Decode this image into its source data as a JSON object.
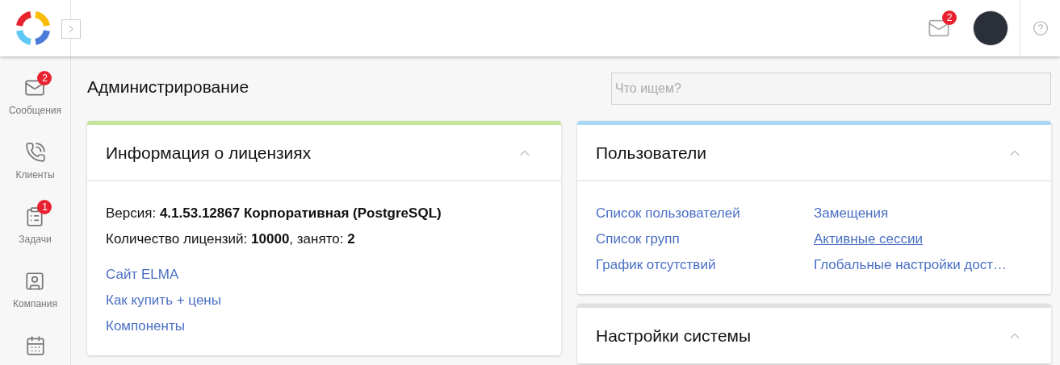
{
  "header": {
    "mail_badge": "2"
  },
  "sidebar": {
    "items": [
      {
        "kind": "messages",
        "label": "Сообщения",
        "badge": "2"
      },
      {
        "kind": "clients",
        "label": "Клиенты"
      },
      {
        "kind": "tasks",
        "label": "Задачи",
        "badge": "1"
      },
      {
        "kind": "company",
        "label": "Компания"
      },
      {
        "kind": "calendar"
      }
    ]
  },
  "page": {
    "title": "Администрирование",
    "search": {
      "placeholder": "Что ищем?"
    }
  },
  "columns": [
    [
      {
        "title": "Информация о лицензиях",
        "color": "#c5e59a",
        "expanded": true,
        "lines": [
          "Версия: **4.1.53.12867 Корпоративная (PostgreSQL)**",
          "Количество лицензий: **10000**, занято: **2**"
        ],
        "link_columns": [
          [
            {
              "label": "Сайт ELMA",
              "hovered": false
            },
            {
              "label": "Как купить + цены",
              "hovered": false
            },
            {
              "label": "Компоненты",
              "hovered": false
            }
          ]
        ]
      }
    ],
    [
      {
        "title": "Пользователи",
        "color": "#a8d8f5",
        "expanded": true,
        "link_columns": [
          [
            {
              "label": "Список пользователей",
              "hovered": false
            },
            {
              "label": "Список групп",
              "hovered": false
            },
            {
              "label": "График отсутствий",
              "hovered": false
            }
          ],
          [
            {
              "label": "Замещения",
              "hovered": false
            },
            {
              "label": "Активные сессии",
              "hovered": true
            },
            {
              "label": "Глобальные настройки дост…",
              "hovered": false
            }
          ]
        ]
      },
      {
        "title": "Настройки системы",
        "color": "#e0e0e0",
        "expanded": true
      }
    ]
  ]
}
